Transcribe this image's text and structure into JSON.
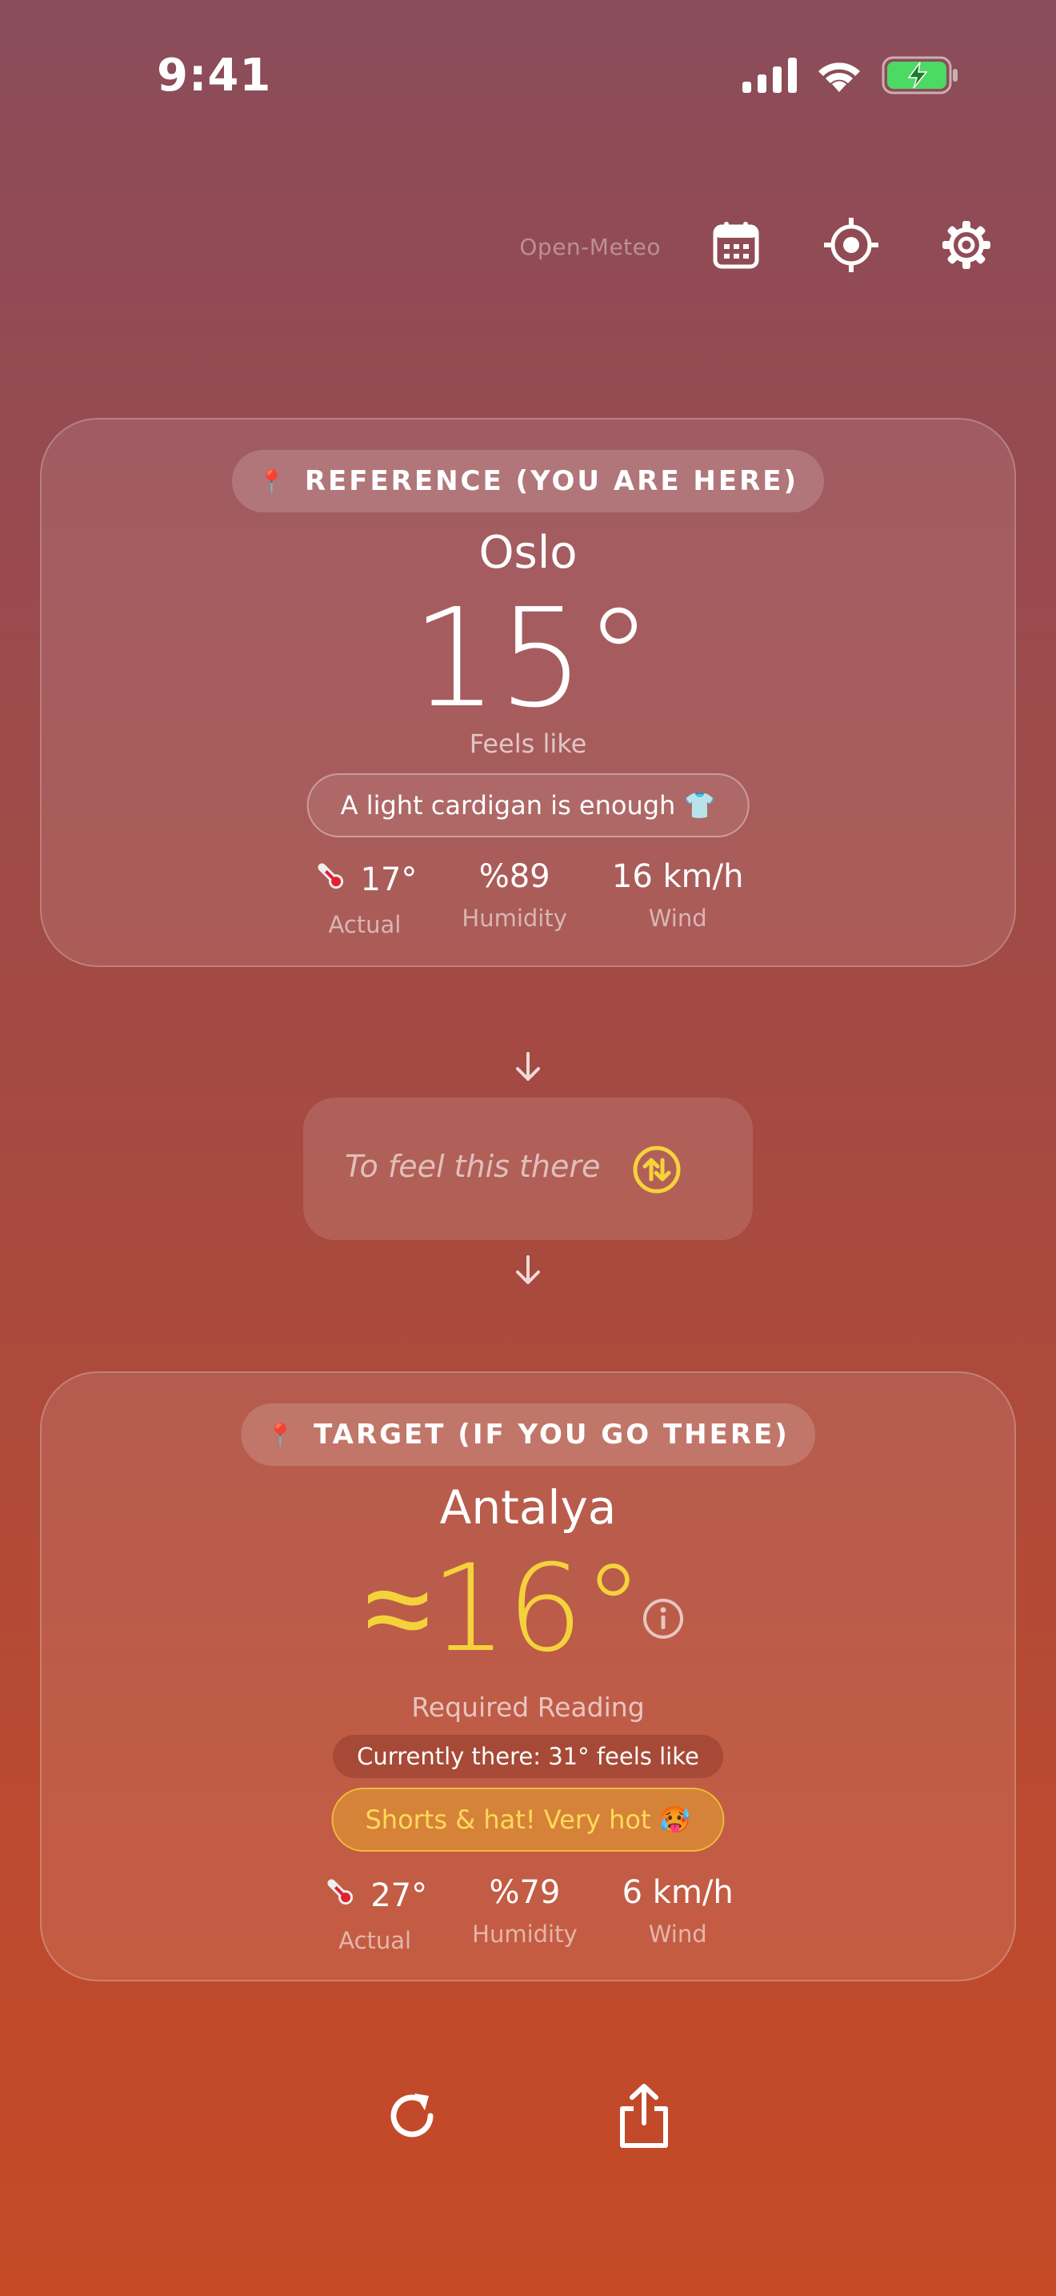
{
  "status_bar": {
    "time": "9:41"
  },
  "toolbar": {
    "source": "Open-Meteo",
    "icons": [
      "calendar-icon",
      "location-target-icon",
      "gear-icon"
    ]
  },
  "reference": {
    "badge": "REFERENCE (YOU ARE HERE)",
    "city": "Oslo",
    "feels_like_temp": "15°",
    "feels_like_label": "Feels like",
    "advice": "A light cardigan is enough 👕",
    "stats": [
      {
        "value": "17°",
        "label": "Actual",
        "icon": "thermometer-icon"
      },
      {
        "value": "%89",
        "label": "Humidity"
      },
      {
        "value": "16 km/h",
        "label": "Wind"
      }
    ]
  },
  "middle": {
    "text": "To feel this there",
    "accent": "#f5d23c"
  },
  "target": {
    "badge": "TARGET (IF YOU GO THERE)",
    "city": "Antalya",
    "required_temp": "≈16°",
    "required_label": "Required Reading",
    "currently": "Currently there: 31° feels like",
    "advice": "Shorts & hat! Very hot 🥵",
    "stats": [
      {
        "value": "27°",
        "label": "Actual",
        "icon": "thermometer-icon"
      },
      {
        "value": "%79",
        "label": "Humidity"
      },
      {
        "value": "6 km/h",
        "label": "Wind"
      }
    ]
  },
  "bottom": {
    "icons": [
      "refresh-icon",
      "share-icon"
    ]
  },
  "colors": {
    "accent_yellow": "#f5d23c",
    "battery_green": "#4cd964",
    "pin_red": "#e23a3a"
  }
}
